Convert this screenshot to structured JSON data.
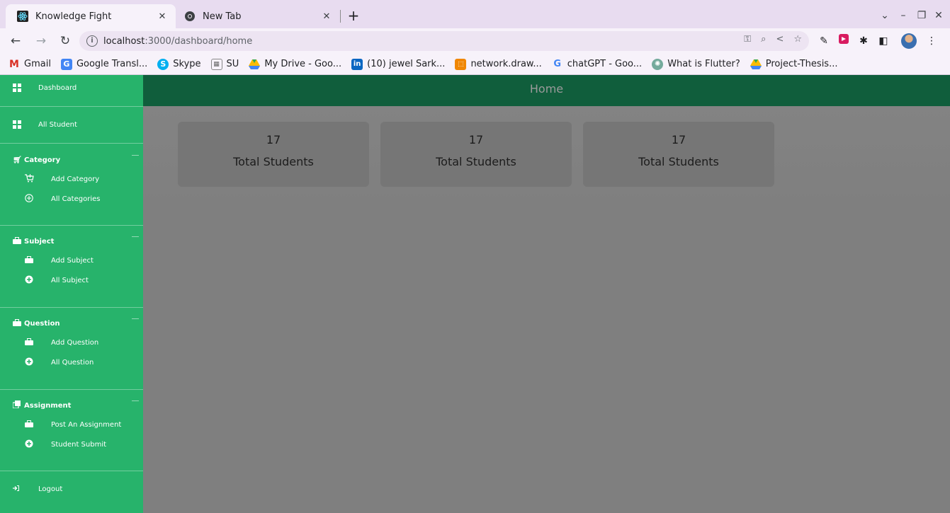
{
  "browser": {
    "tabs": [
      {
        "title": "Knowledge Fight",
        "active": true
      },
      {
        "title": "New Tab",
        "active": false
      }
    ],
    "url_host": "localhost",
    "url_path": ":3000/dashboard/home",
    "bookmarks": [
      {
        "label": "Gmail",
        "icon": "gmail-icon"
      },
      {
        "label": "Google Transl...",
        "icon": "google-translate-icon"
      },
      {
        "label": "Skype",
        "icon": "skype-icon"
      },
      {
        "label": "SU",
        "icon": "su-icon"
      },
      {
        "label": "My Drive - Goo...",
        "icon": "google-drive-icon"
      },
      {
        "label": "(10) jewel Sark...",
        "icon": "linkedin-icon"
      },
      {
        "label": "network.draw...",
        "icon": "drawio-icon"
      },
      {
        "label": "chatGPT - Goo...",
        "icon": "google-icon"
      },
      {
        "label": "What is Flutter?",
        "icon": "openai-icon"
      },
      {
        "label": "Project-Thesis...",
        "icon": "google-drive-icon"
      }
    ]
  },
  "sidebar": {
    "dashboard": "Dashboard",
    "all_student": "All Student",
    "category": {
      "title": "Category",
      "items": [
        "Add Category",
        "All Categories"
      ]
    },
    "subject": {
      "title": "Subject",
      "items": [
        "Add Subject",
        "All Subject"
      ]
    },
    "question": {
      "title": "Question",
      "items": [
        "Add Question",
        "All Question"
      ]
    },
    "assignment": {
      "title": "Assignment",
      "items": [
        "Post An Assignment",
        "Student Submit"
      ]
    },
    "logout": "Logout"
  },
  "header": {
    "title": "Home"
  },
  "cards": [
    {
      "value": "17",
      "label": "Total Students"
    },
    {
      "value": "17",
      "label": "Total Students"
    },
    {
      "value": "17",
      "label": "Total Students"
    }
  ],
  "colors": {
    "sidebar": "#27b36b",
    "topbar": "#105e3c",
    "overlay": "#7f7f7f"
  }
}
